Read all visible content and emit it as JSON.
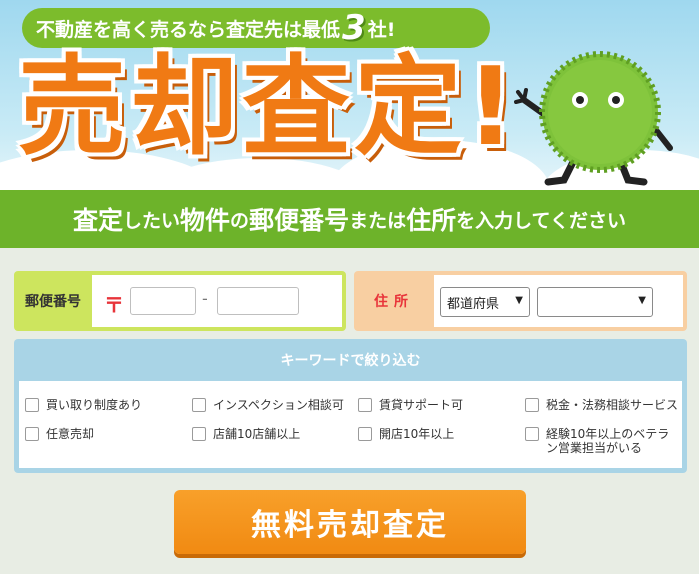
{
  "hero": {
    "tagline_before": "不動産を高く売るなら査定先は最低",
    "tagline_number": "3",
    "tagline_after": "社!",
    "headline": "売却査定!"
  },
  "band": {
    "part1": "査定",
    "part2": "したい",
    "part3": "物件",
    "part4": "の",
    "part5": "郵便番号",
    "part6": "または",
    "part7": "住所",
    "part8": "を入力してください"
  },
  "zip": {
    "label": "郵便番号",
    "mark": "〒",
    "dash": "-",
    "first_value": "",
    "second_value": ""
  },
  "address": {
    "label": "住所",
    "prefecture_selected": "都道府県",
    "city_selected": ""
  },
  "keywords": {
    "title": "キーワードで絞り込む",
    "items": [
      {
        "label": "買い取り制度あり"
      },
      {
        "label": "インスペクション相談可"
      },
      {
        "label": "賃貸サポート可"
      },
      {
        "label": "税金・法務相談サービス"
      },
      {
        "label": "任意売却"
      },
      {
        "label": "店舗10店舗以上"
      },
      {
        "label": "開店10年以上"
      },
      {
        "label": "経験10年以上のベテラン営業担当がいる"
      }
    ]
  },
  "submit": {
    "label": "無料売却査定"
  },
  "colors": {
    "green": "#6db32a",
    "orange": "#f07a14",
    "button": "#f18a12",
    "red": "#e8343a"
  }
}
